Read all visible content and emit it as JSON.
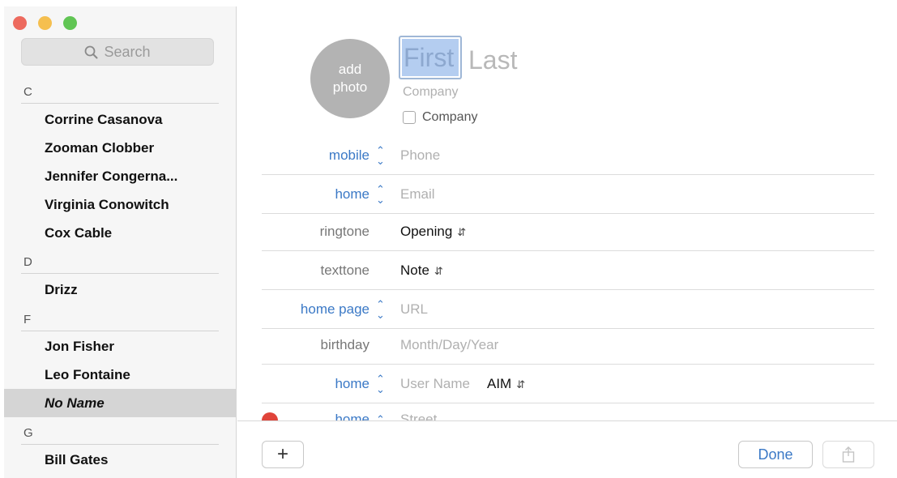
{
  "window": {
    "controls": [
      "close",
      "minimize",
      "zoom"
    ]
  },
  "sidebar": {
    "search_placeholder": "Search",
    "sections": [
      {
        "letter": "C",
        "contacts": [
          "Corrine Casanova",
          "Zooman Clobber",
          "Jennifer Congerna...",
          "Virginia Conowitch",
          "Cox Cable"
        ]
      },
      {
        "letter": "D",
        "contacts": [
          "Drizz"
        ]
      },
      {
        "letter": "F",
        "contacts": [
          "Jon Fisher",
          "Leo Fontaine",
          "No Name"
        ]
      },
      {
        "letter": "G",
        "contacts": [
          "Bill Gates"
        ]
      }
    ],
    "selected_contact": "No Name"
  },
  "card": {
    "avatar": {
      "line1": "add",
      "line2": "photo"
    },
    "first_name_placeholder": "First",
    "last_name_placeholder": "Last",
    "company_placeholder": "Company",
    "company_checkbox_label": "Company",
    "company_checkbox_checked": false,
    "fields": {
      "mobile": {
        "label": "mobile",
        "placeholder": "Phone"
      },
      "email": {
        "label": "home",
        "placeholder": "Email"
      },
      "ringtone": {
        "label": "ringtone",
        "value": "Opening"
      },
      "texttone": {
        "label": "texttone",
        "value": "Note"
      },
      "homepage": {
        "label": "home page",
        "placeholder": "URL"
      },
      "birthday": {
        "label": "birthday",
        "placeholder": "Month/Day/Year"
      },
      "im": {
        "label": "home",
        "placeholder": "User Name",
        "service": "AIM"
      },
      "address": {
        "label": "home",
        "placeholder": "Street"
      }
    }
  },
  "footer": {
    "add_label": "+",
    "done_label": "Done"
  },
  "icons": {
    "search": "magnifier-icon",
    "stepper": "up-down-chevron-icon",
    "share": "share-icon",
    "remove": "remove-field-icon"
  },
  "colors": {
    "accent_blue": "#3b79c6",
    "selection": "#b4cdf0",
    "remove_red": "#e0443a"
  }
}
